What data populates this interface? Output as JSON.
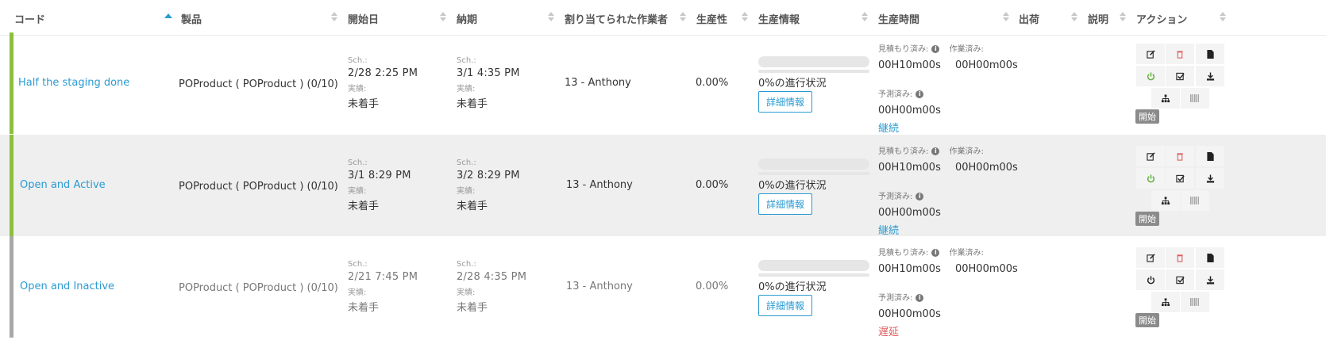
{
  "headers": {
    "code": "コード",
    "product": "製品",
    "start": "開始日",
    "due": "納期",
    "assignee": "割り当てられた作業者",
    "productivity": "生産性",
    "prod_info": "生産情報",
    "prod_time": "生産時間",
    "ship": "出荷",
    "desc": "説明",
    "action": "アクション"
  },
  "labels": {
    "sch": "Sch.:",
    "actual": "実績:",
    "est": "見積もり済み:",
    "worked": "作業済み:",
    "forecast": "予測済み:",
    "detail": "詳細情報",
    "start_badge": "開始"
  },
  "rows": [
    {
      "code": "Half the staging done",
      "product": "POProduct ( POProduct ) (0/10)",
      "start_sch": "2/28   2:25 PM",
      "start_actual": "未着手",
      "due_sch": "3/1   4:35 PM",
      "due_actual": "未着手",
      "assignee": "13 - Anthony",
      "productivity": "0.00%",
      "progress_text": "0%の進行状況",
      "progress": 0,
      "est_time": "00H10m00s",
      "worked_time": "00H00m00s",
      "forecast_time": "00H00m00s",
      "status_link": "継続",
      "status_color": "#2b9bd2",
      "bar_color": "#8cbf3f"
    },
    {
      "code": "Open and Active",
      "product": "POProduct ( POProduct ) (0/10)",
      "start_sch": "3/1   8:29 PM",
      "start_actual": "未着手",
      "due_sch": "3/2   8:29 PM",
      "due_actual": "未着手",
      "assignee": "13 - Anthony",
      "productivity": "0.00%",
      "progress_text": "0%の進行状況",
      "progress": 0,
      "est_time": "00H10m00s",
      "worked_time": "00H00m00s",
      "forecast_time": "00H00m00s",
      "status_link": "継続",
      "status_color": "#2b9bd2",
      "bar_color": "#8cbf3f"
    },
    {
      "code": "Open and Inactive",
      "product": "POProduct ( POProduct ) (0/10)",
      "start_sch": "2/21   7:45 PM",
      "start_actual": "未着手",
      "due_sch": "2/28   4:35 PM",
      "due_actual": "未着手",
      "assignee": "13 - Anthony",
      "productivity": "0.00%",
      "progress_text": "0%の進行状況",
      "progress": 0,
      "est_time": "00H10m00s",
      "worked_time": "00H00m00s",
      "forecast_time": "00H00m00s",
      "status_link": "遅延",
      "status_color": "#e05a5a",
      "bar_color": "#a8a8a8"
    }
  ],
  "action_icons": [
    "edit-icon",
    "delete-icon",
    "document-icon",
    "power-icon",
    "check-icon",
    "download-icon",
    "hierarchy-icon",
    "barcode-icon"
  ]
}
